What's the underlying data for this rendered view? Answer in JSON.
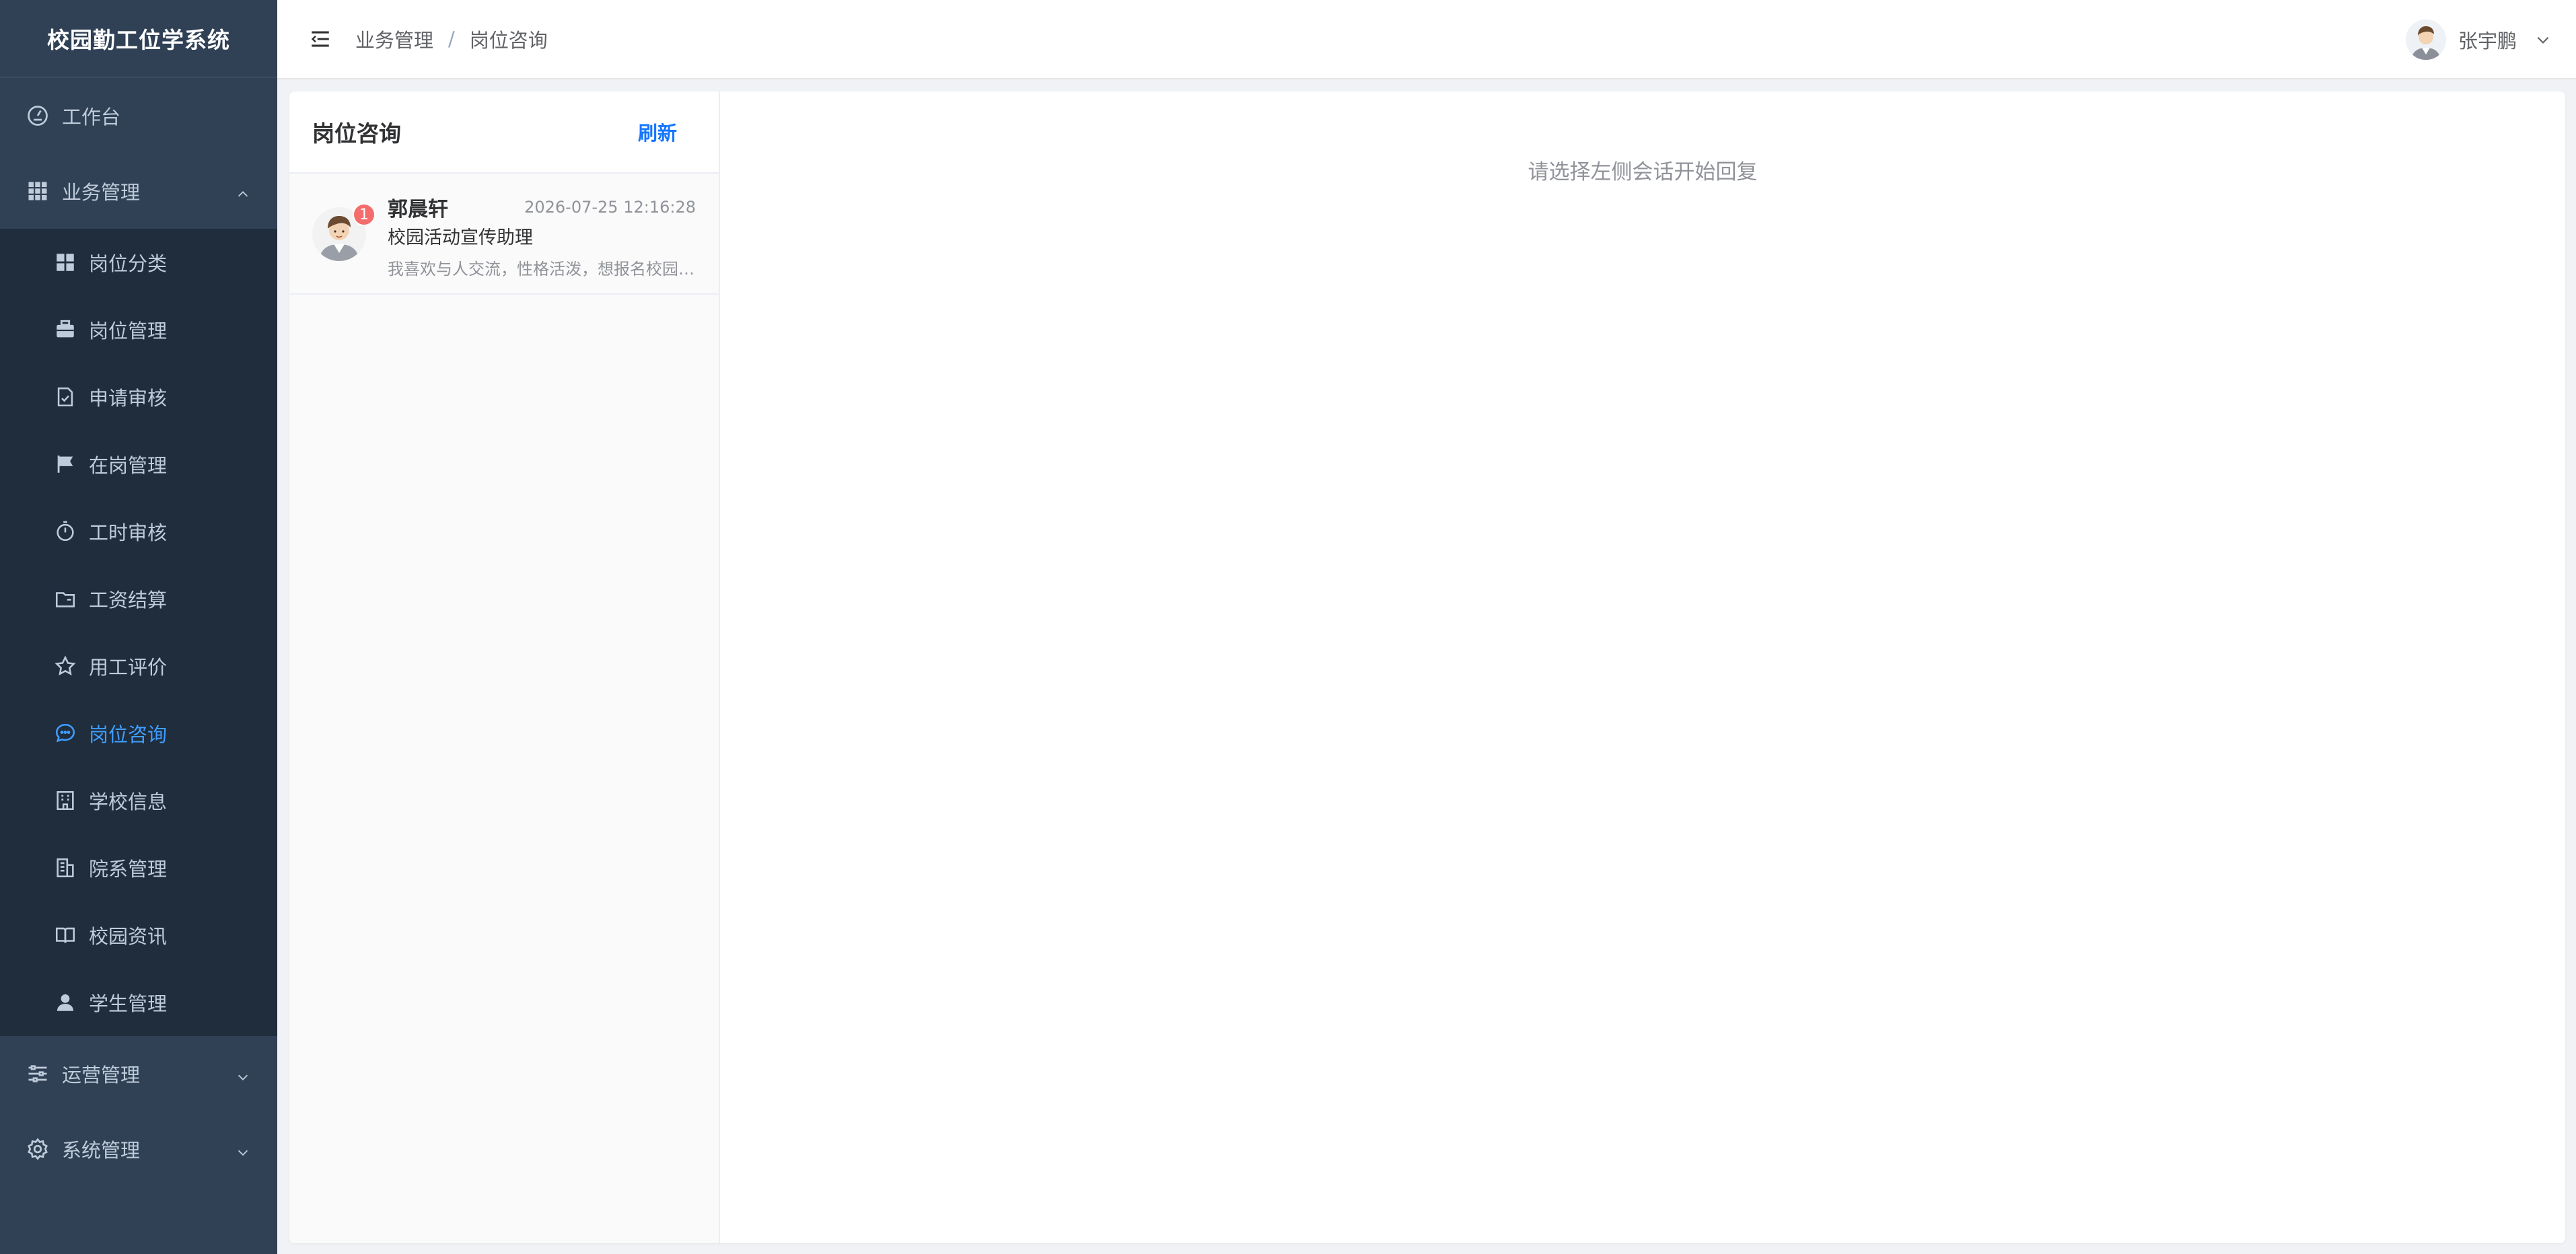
{
  "app": {
    "title": "校园勤工位学系统"
  },
  "sidebar": {
    "items": [
      {
        "label": "工作台",
        "icon": "dashboard-icon"
      },
      {
        "label": "业务管理",
        "icon": "grid-icon",
        "expanded": true,
        "children": [
          {
            "label": "岗位分类",
            "icon": "category-icon"
          },
          {
            "label": "岗位管理",
            "icon": "briefcase-icon"
          },
          {
            "label": "申请审核",
            "icon": "document-check-icon"
          },
          {
            "label": "在岗管理",
            "icon": "flag-icon"
          },
          {
            "label": "工时审核",
            "icon": "timer-icon"
          },
          {
            "label": "工资结算",
            "icon": "folder-icon"
          },
          {
            "label": "用工评价",
            "icon": "star-icon"
          },
          {
            "label": "岗位咨询",
            "icon": "chat-icon",
            "active": true
          },
          {
            "label": "学校信息",
            "icon": "office-building-icon"
          },
          {
            "label": "院系管理",
            "icon": "school-icon"
          },
          {
            "label": "校园资讯",
            "icon": "reading-icon"
          },
          {
            "label": "学生管理",
            "icon": "user-icon"
          }
        ]
      },
      {
        "label": "运营管理",
        "icon": "sliders-icon"
      },
      {
        "label": "系统管理",
        "icon": "settings-icon"
      }
    ]
  },
  "header": {
    "breadcrumb": [
      "业务管理",
      "岗位咨询"
    ],
    "separator": "/",
    "user_name": "张宇鹏"
  },
  "conversations": {
    "title": "岗位咨询",
    "refresh_label": "刷新",
    "items": [
      {
        "name": "郭晨轩",
        "time": "2026-07-25 12:16:28",
        "job": "校园活动宣传助理",
        "preview": "我喜欢与人交流，性格活泼，想报名校园活动宣传助理岗位",
        "unread": "1"
      }
    ]
  },
  "chat": {
    "empty_tip": "请选择左侧会话开始回复"
  },
  "colors": {
    "sidebar_bg": "#304156",
    "sidebar_text": "#bfcbd9",
    "active": "#409eff",
    "link": "#1677ff",
    "badge": "#f56c6c"
  }
}
